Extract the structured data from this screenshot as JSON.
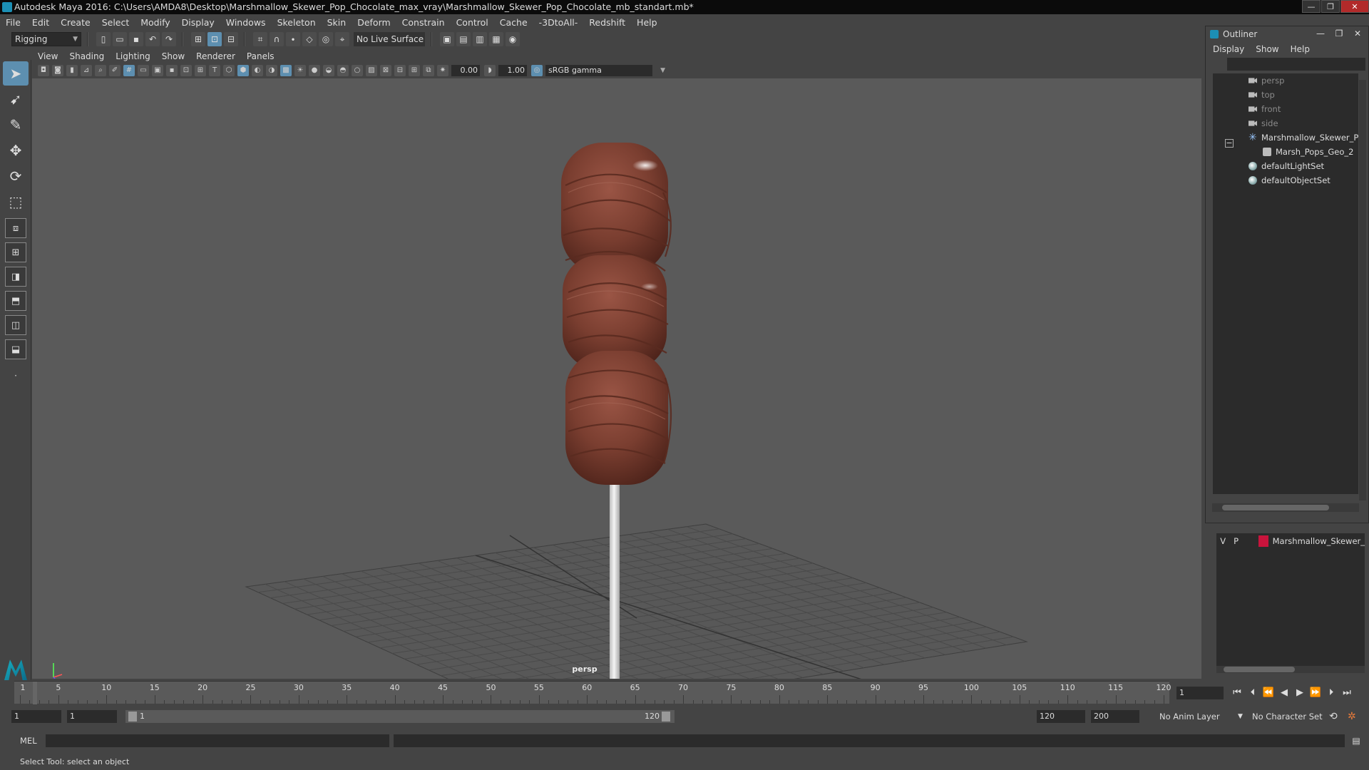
{
  "window": {
    "title": "Autodesk Maya 2016: C:\\Users\\AMDA8\\Desktop\\Marshmallow_Skewer_Pop_Chocolate_max_vray\\Marshmallow_Skewer_Pop_Chocolate_mb_standart.mb*",
    "min": "—",
    "max": "❐",
    "close": "✕"
  },
  "menubar": [
    "File",
    "Edit",
    "Create",
    "Select",
    "Modify",
    "Display",
    "Windows",
    "Skeleton",
    "Skin",
    "Deform",
    "Constrain",
    "Control",
    "Cache",
    "-3DtoAll-",
    "Redshift",
    "Help"
  ],
  "statusline": {
    "mode": "Rigging",
    "live_surface": "No Live Surface"
  },
  "viewport": {
    "menu": [
      "View",
      "Shading",
      "Lighting",
      "Show",
      "Renderer",
      "Panels"
    ],
    "exposure": "0.00",
    "gamma": "1.00",
    "color_space": "sRGB gamma",
    "camera": "persp"
  },
  "outliner": {
    "title": "Outliner",
    "menu": [
      "Display",
      "Show",
      "Help"
    ],
    "items": [
      {
        "label": "persp",
        "type": "camera"
      },
      {
        "label": "top",
        "type": "camera"
      },
      {
        "label": "front",
        "type": "camera"
      },
      {
        "label": "side",
        "type": "camera"
      },
      {
        "label": "Marshmallow_Skewer_Pop_",
        "type": "group"
      },
      {
        "label": "Marsh_Pops_Geo_2",
        "type": "mesh"
      },
      {
        "label": "defaultLightSet",
        "type": "set"
      },
      {
        "label": "defaultObjectSet",
        "type": "set"
      }
    ],
    "expander": "−"
  },
  "layers": {
    "visible": "V",
    "playback": "P",
    "name": "Marshmallow_Skewer_",
    "color": "#c8143c"
  },
  "timeline": {
    "ticks": [
      "1",
      "5",
      "10",
      "15",
      "20",
      "25",
      "30",
      "35",
      "40",
      "45",
      "50",
      "55",
      "60",
      "65",
      "70",
      "75",
      "80",
      "85",
      "90",
      "95",
      "100",
      "105",
      "110",
      "115",
      "120"
    ],
    "current_frame": "1"
  },
  "range": {
    "start": "1",
    "anim_start": "1",
    "slider_start": "1",
    "slider_end": "120",
    "anim_end": "120",
    "end": "200",
    "anim_layer": "No Anim Layer",
    "character_set": "No Character Set"
  },
  "command": {
    "type": "MEL"
  },
  "help_line": "Select Tool: select an object",
  "colors": {
    "chocolate": "#7a3e30",
    "stick": "#e8e8e8",
    "accent": "#5d8fb0"
  }
}
